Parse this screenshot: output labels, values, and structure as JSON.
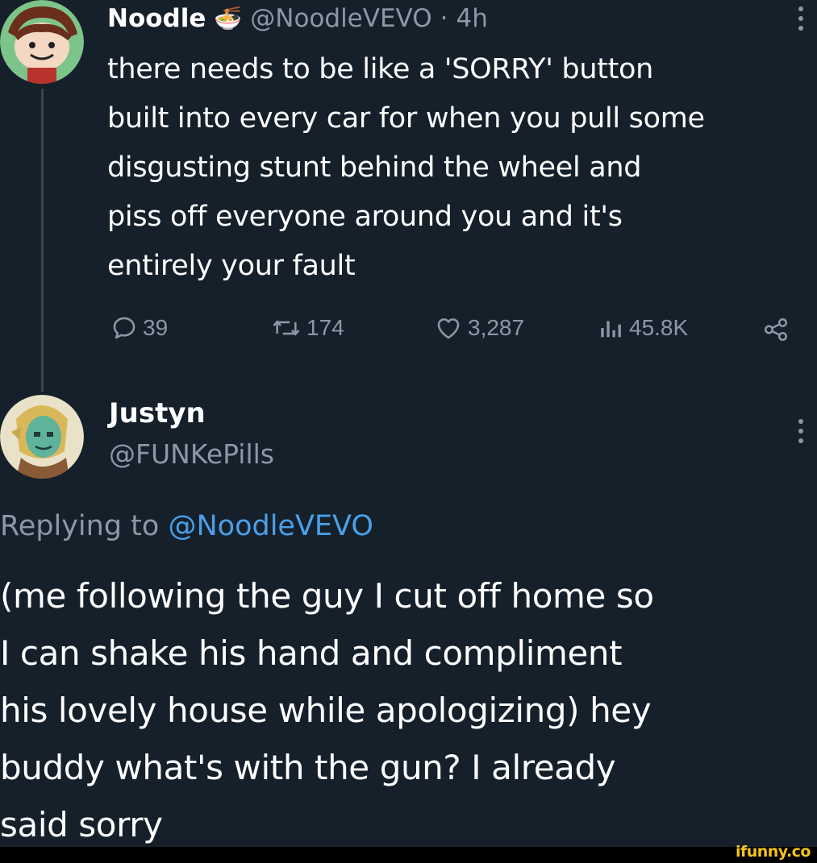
{
  "tweet": {
    "author_name": "Noodle",
    "author_emoji": "🍜",
    "author_handle": "@NoodleVEVO",
    "time_sep": "·",
    "time": "4h",
    "text_lines": [
      "there needs to be like a 'SORRY' button",
      "built into every car for when you pull some",
      "disgusting stunt behind the wheel and",
      "piss off everyone around you and it's",
      "entirely your fault"
    ],
    "actions": {
      "replies": "39",
      "retweets": "174",
      "likes": "3,287",
      "views": "45.8K"
    }
  },
  "reply": {
    "author_name": "Justyn",
    "author_handle": "@FUNKePills",
    "replying_prefix": "Replying to",
    "replying_mention": "@NoodleVEVO",
    "text_lines": [
      "(me following the guy I cut off home so",
      "I can shake his hand and compliment",
      "his lovely house while apologizing) hey",
      "buddy what's with the gun? I already",
      "said sorry"
    ]
  },
  "watermark": "ifunny.co",
  "colors": {
    "background": "#15202b",
    "secondary_text": "#8b98a5",
    "link": "#4b9fe8",
    "watermark": "#f5c518"
  },
  "icons": [
    "reply-icon",
    "retweet-icon",
    "like-icon",
    "views-icon",
    "share-icon",
    "more-icon"
  ]
}
